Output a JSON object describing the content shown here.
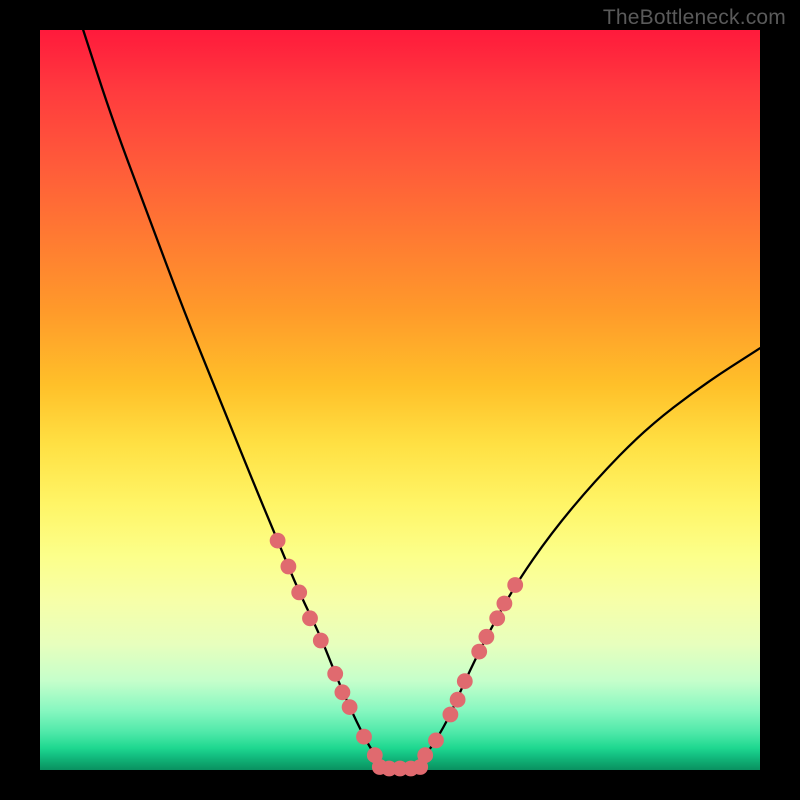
{
  "watermark": "TheBottleneck.com",
  "chart_data": {
    "type": "line",
    "title": "",
    "xlabel": "",
    "ylabel": "",
    "xlim": [
      0,
      100
    ],
    "ylim": [
      0,
      100
    ],
    "series": [
      {
        "name": "bottleneck-curve",
        "x": [
          6,
          10,
          15,
          20,
          25,
          30,
          33,
          36,
          39,
          41,
          43,
          45,
          46.5,
          48,
          50,
          52,
          53.5,
          55,
          57,
          59,
          62,
          66,
          71,
          77,
          84,
          92,
          100
        ],
        "y": [
          100,
          88,
          75,
          62,
          50,
          38,
          31,
          24,
          18,
          13,
          8.5,
          4.5,
          2,
          0.5,
          0,
          0.5,
          2,
          4,
          7.5,
          12,
          18,
          25,
          32,
          39,
          46,
          52,
          57
        ]
      }
    ],
    "flat_segment": {
      "x_start": 47,
      "x_end": 53,
      "y": 0.2
    },
    "markers": {
      "name": "curve-points",
      "color": "#e06a6f",
      "radius": 1.1,
      "points": [
        {
          "x": 33,
          "y": 31
        },
        {
          "x": 34.5,
          "y": 27.5
        },
        {
          "x": 36,
          "y": 24
        },
        {
          "x": 37.5,
          "y": 20.5
        },
        {
          "x": 39,
          "y": 17.5
        },
        {
          "x": 41,
          "y": 13
        },
        {
          "x": 42,
          "y": 10.5
        },
        {
          "x": 43,
          "y": 8.5
        },
        {
          "x": 45,
          "y": 4.5
        },
        {
          "x": 46.5,
          "y": 2
        },
        {
          "x": 47.2,
          "y": 0.4
        },
        {
          "x": 48.5,
          "y": 0.2
        },
        {
          "x": 50,
          "y": 0.2
        },
        {
          "x": 51.5,
          "y": 0.2
        },
        {
          "x": 52.8,
          "y": 0.4
        },
        {
          "x": 53.5,
          "y": 2
        },
        {
          "x": 55,
          "y": 4
        },
        {
          "x": 57,
          "y": 7.5
        },
        {
          "x": 58,
          "y": 9.5
        },
        {
          "x": 59,
          "y": 12
        },
        {
          "x": 61,
          "y": 16
        },
        {
          "x": 62,
          "y": 18
        },
        {
          "x": 63.5,
          "y": 20.5
        },
        {
          "x": 64.5,
          "y": 22.5
        },
        {
          "x": 66,
          "y": 25
        }
      ]
    }
  }
}
